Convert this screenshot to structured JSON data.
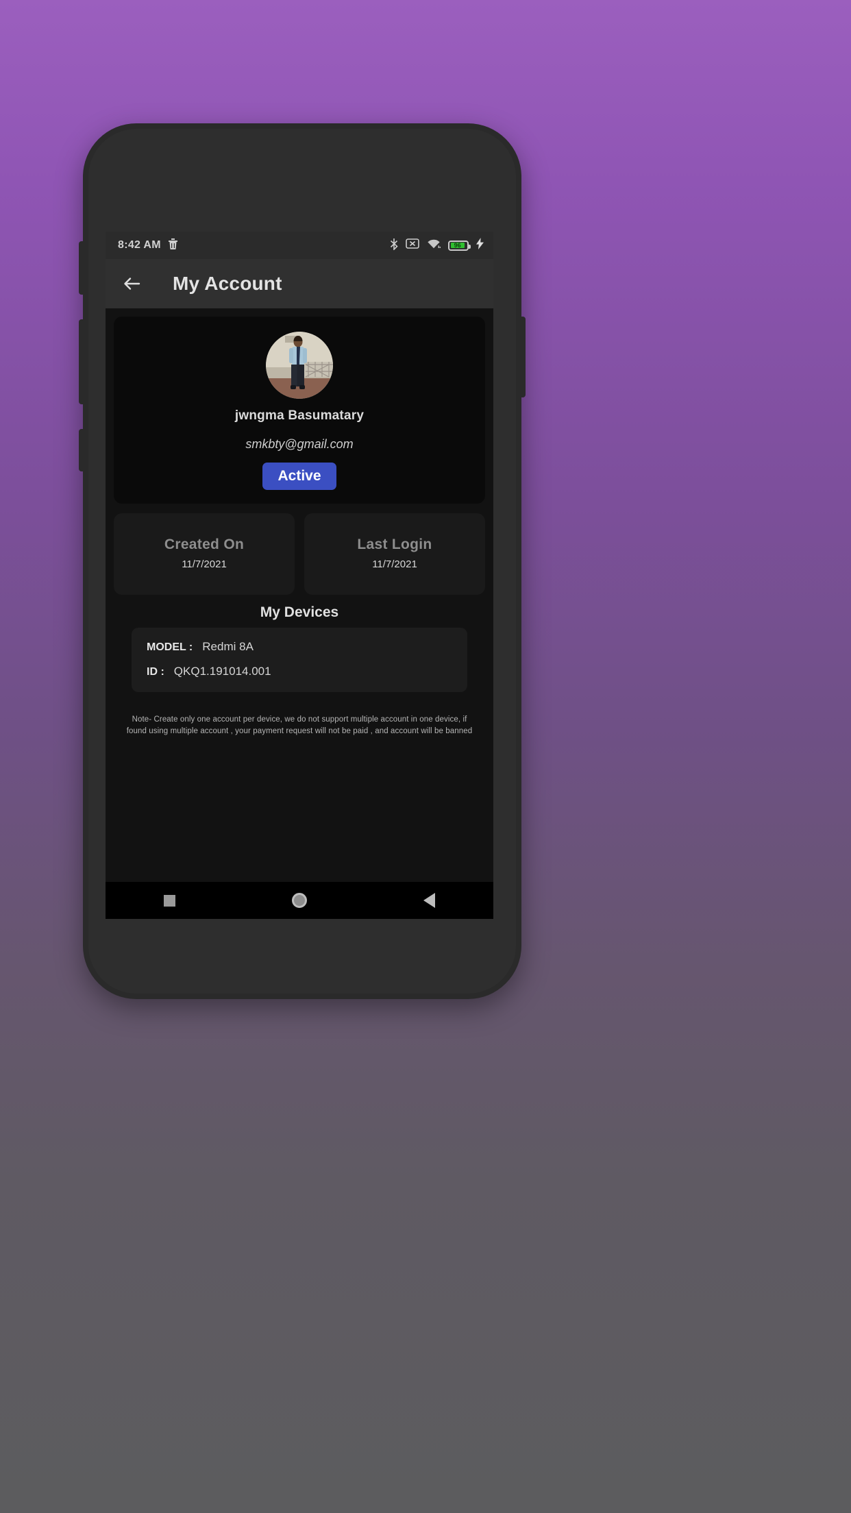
{
  "statusbar": {
    "time": "8:42 AM",
    "left_icons": [
      "trash-icon"
    ],
    "right_icons": [
      "bluetooth-icon",
      "no-sim-icon",
      "wifi-icon",
      "battery-icon",
      "charging-bolt-icon"
    ],
    "battery_percent": "96",
    "battery_color": "#2fbf2f"
  },
  "appbar": {
    "back_icon": "back-arrow-icon",
    "title": "My Account"
  },
  "profile": {
    "avatar_alt": "user-profile-photo",
    "name": "jwngma Basumatary",
    "email": "smkbty@gmail.com",
    "status_label": "Active",
    "status_color": "#3b4fc2"
  },
  "stats": [
    {
      "label": "Created On",
      "value": "11/7/2021"
    },
    {
      "label": "Last Login",
      "value": "11/7/2021"
    }
  ],
  "devices": {
    "section_title": "My Devices",
    "rows": [
      {
        "key": "MODEL :",
        "value": "Redmi 8A"
      },
      {
        "key": "ID :",
        "value": "QKQ1.191014.001"
      }
    ]
  },
  "note": "Note- Create only one account per device, we do not support multiple account in one device, if found using multiple account , your payment request will not be paid , and account will be banned",
  "navbar": {
    "recents": "recents-square-icon",
    "home": "home-circle-icon",
    "back": "back-triangle-icon"
  }
}
